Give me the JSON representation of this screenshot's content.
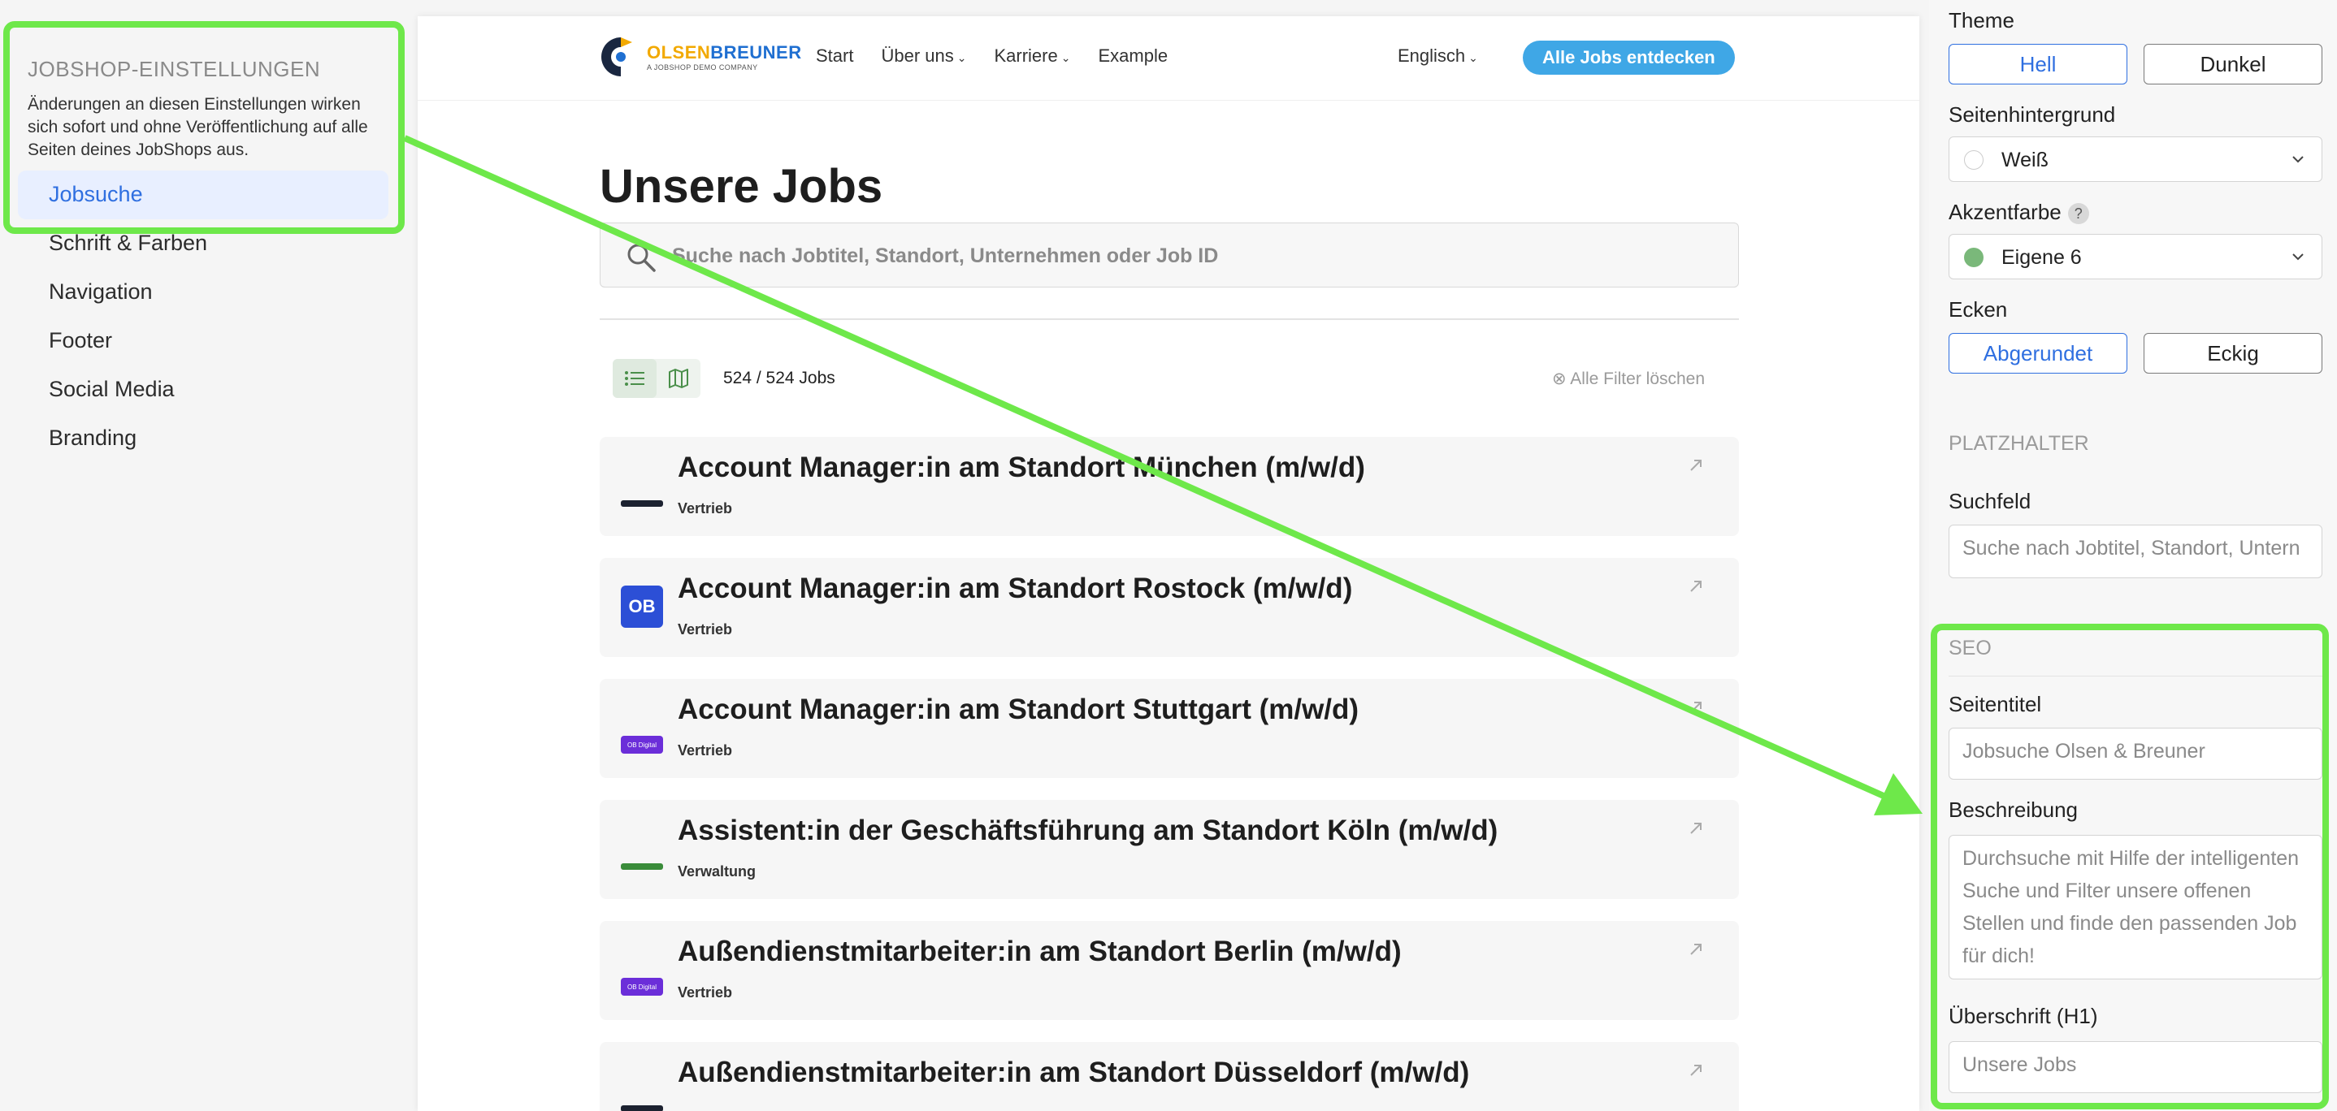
{
  "sidebar": {
    "section_title": "JOBSHOP-EINSTELLUNGEN",
    "description": "Änderungen an diesen Einstellungen wirken sich sofort und ohne Veröffentlichung auf alle Seiten deines JobShops aus.",
    "items": [
      {
        "label": "Jobsuche",
        "active": true
      },
      {
        "label": "Schrift & Farben"
      },
      {
        "label": "Navigation"
      },
      {
        "label": "Footer"
      },
      {
        "label": "Social Media"
      },
      {
        "label": "Branding"
      }
    ]
  },
  "preview": {
    "logo": {
      "name_part1": "OLSEN",
      "name_part2": "BREUNER",
      "subtitle": "A JOBSHOP DEMO COMPANY"
    },
    "nav": [
      "Start",
      "Über uns",
      "Karriere",
      "Example"
    ],
    "language": "Englisch",
    "cta": "Alle Jobs entdecken",
    "heading": "Unsere Jobs",
    "search_placeholder": "Suche nach Jobtitel, Standort, Unternehmen oder Job ID",
    "job_count": "524 / 524 Jobs",
    "clear_filters": "Alle Filter löschen",
    "jobs": [
      {
        "title": "Account Manager:in am Standort München (m/w/d)",
        "department": "Vertrieb",
        "logo": "bar",
        "logo_color": "#1c2230"
      },
      {
        "title": "Account Manager:in am Standort Rostock (m/w/d)",
        "department": "Vertrieb",
        "logo": "box",
        "logo_text": "OB",
        "logo_color": "#2c4fd6"
      },
      {
        "title": "Account Manager:in am Standort Stuttgart (m/w/d)",
        "department": "Vertrieb",
        "logo": "pill",
        "logo_text": "OB Digital",
        "logo_color": "#6b2ed9"
      },
      {
        "title": "Assistent:in der Geschäftsführung am Standort Köln (m/w/d)",
        "department": "Verwaltung",
        "logo": "bar",
        "logo_color": "#3a8c3a"
      },
      {
        "title": "Außendienstmitarbeiter:in am Standort Berlin (m/w/d)",
        "department": "Vertrieb",
        "logo": "pill",
        "logo_text": "OB Digital",
        "logo_color": "#6b2ed9"
      },
      {
        "title": "Außendienstmitarbeiter:in am Standort Düsseldorf (m/w/d)",
        "department": "",
        "logo": "bar",
        "logo_color": "#1c2230"
      }
    ]
  },
  "settings": {
    "theme_label": "Theme",
    "theme_options": [
      "Hell",
      "Dunkel"
    ],
    "background_label": "Seitenhintergrund",
    "background_value": "Weiß",
    "accent_label": "Akzentfarbe",
    "accent_help": "?",
    "accent_value": "Eigene 6",
    "accent_color": "#7ab87a",
    "corners_label": "Ecken",
    "corner_options": [
      "Abgerundet",
      "Eckig"
    ],
    "placeholder_section": "PLATZHALTER",
    "search_field_label": "Suchfeld",
    "search_field_value": "Suche nach Jobtitel, Standort, Untern",
    "seo_section": "SEO",
    "page_title_label": "Seitentitel",
    "page_title_value": "Jobsuche Olsen & Breuner",
    "description_label": "Beschreibung",
    "description_value": "Durchsuche mit Hilfe der intelligenten Suche und Filter unsere offenen Stellen und finde den passenden Job für dich!",
    "h1_label": "Überschrift (H1)",
    "h1_value": "Unsere Jobs"
  },
  "colors": {
    "highlight": "#6ee84a",
    "accent_blue": "#2f6fe0",
    "cta_blue": "#3fa7e6"
  }
}
